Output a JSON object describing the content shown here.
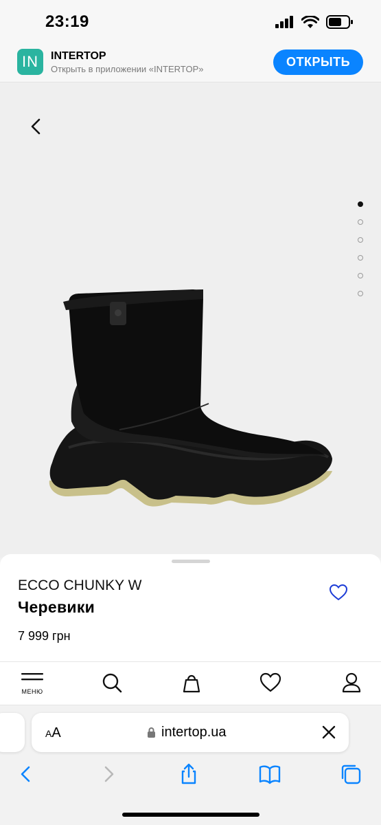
{
  "status": {
    "time": "23:19"
  },
  "banner": {
    "logo_text": "IN",
    "app_name": "INTERTOP",
    "subtitle": "Открыть в приложении «INTERTOP»",
    "open_label": "ОТКРЫТЬ",
    "colors": {
      "logo": "#2ab4a0",
      "button": "#0a84ff"
    }
  },
  "gallery": {
    "image_icon": "boot-image",
    "dots_count": 6,
    "active_dot": 1
  },
  "product": {
    "brand": "ECCO CHUNKY W",
    "type": "Черевики",
    "price": "7 999 грн"
  },
  "site_nav": {
    "menu_label": "МЕНЮ",
    "items": [
      "menu-icon",
      "search-icon",
      "bag-icon",
      "heart-icon",
      "user-icon"
    ]
  },
  "browser": {
    "aa_small": "A",
    "aa_big": "A",
    "url": "intertop.ua"
  }
}
